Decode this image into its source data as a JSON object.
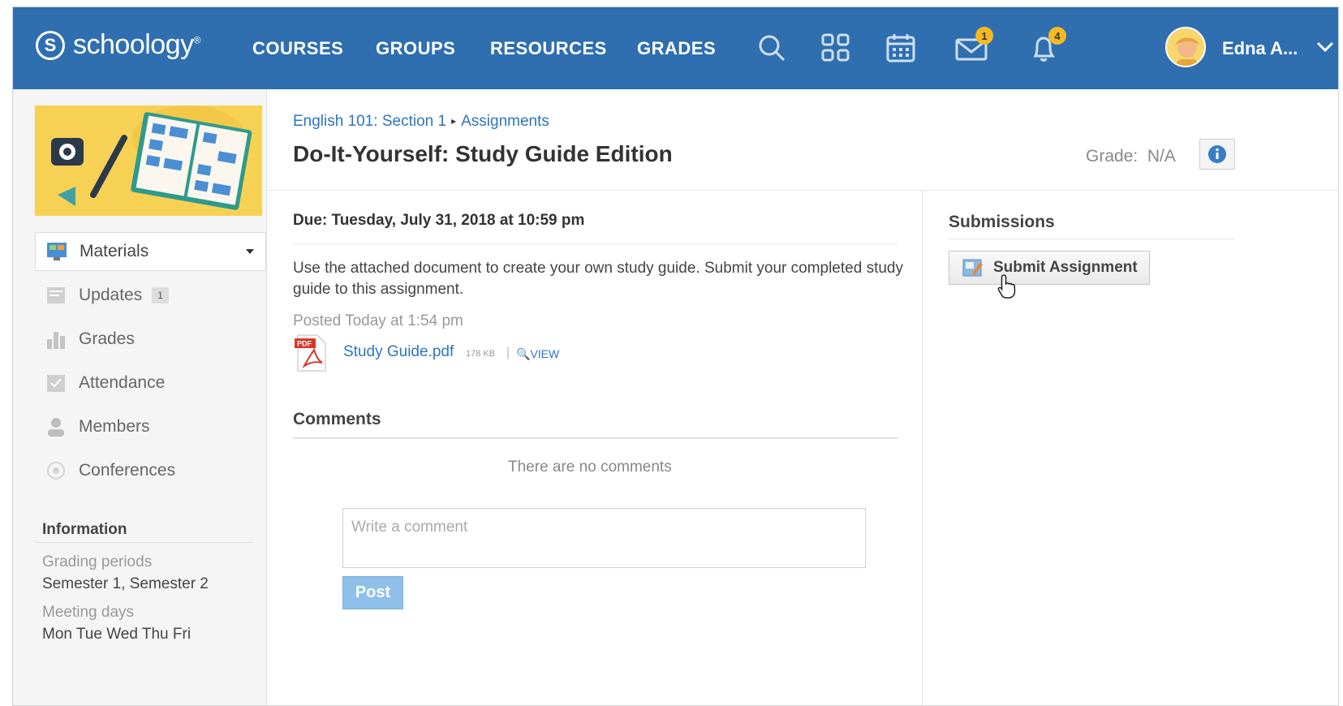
{
  "app": {
    "logo_text": "schoology",
    "logo_mark": "S"
  },
  "nav": {
    "items": [
      {
        "label": "COURSES"
      },
      {
        "label": "GROUPS"
      },
      {
        "label": "RESOURCES"
      },
      {
        "label": "GRADES"
      }
    ],
    "icons": [
      "search-icon",
      "apps-grid-icon",
      "calendar-icon",
      "messages-icon",
      "notifications-icon"
    ],
    "message_count": "1",
    "notification_count": "4",
    "user_name": "Edna A..."
  },
  "sidebar": {
    "menu": [
      {
        "label": "Materials",
        "icon": "materials-icon"
      },
      {
        "label": "Updates",
        "icon": "updates-icon",
        "badge": "1"
      },
      {
        "label": "Grades",
        "icon": "grades-icon"
      },
      {
        "label": "Attendance",
        "icon": "attendance-icon"
      },
      {
        "label": "Members",
        "icon": "members-icon"
      },
      {
        "label": "Conferences",
        "icon": "conferences-icon"
      }
    ],
    "information": {
      "title": "Information",
      "grading_label": "Grading periods",
      "grading_value": "Semester 1, Semester 2",
      "meeting_label": "Meeting days",
      "meeting_value": "Mon Tue Wed Thu Fri"
    }
  },
  "main": {
    "breadcrumb": {
      "course": "English 101: Section 1",
      "section": "Assignments"
    },
    "title": "Do-It-Yourself: Study Guide Edition",
    "grade_label": "Grade:",
    "grade_value": "N/A",
    "due": "Due: Tuesday, July 31, 2018 at 10:59 pm",
    "description": "Use the attached document to create your own study guide. Submit your completed study guide to this assignment.",
    "posted": "Posted Today at 1:54 pm",
    "attachment": {
      "name": "Study Guide.pdf",
      "size": "178 KB",
      "separator": "|",
      "view_label": "VIEW"
    },
    "comments": {
      "heading": "Comments",
      "empty_text": "There are no comments",
      "placeholder": "Write a comment",
      "post_label": "Post"
    }
  },
  "submissions": {
    "heading": "Submissions",
    "submit_label": "Submit Assignment"
  },
  "colors": {
    "topbar": "#2f6fb0",
    "link": "#2f74c1",
    "badge": "#f6b921",
    "post_button": "#8fc0ea"
  }
}
